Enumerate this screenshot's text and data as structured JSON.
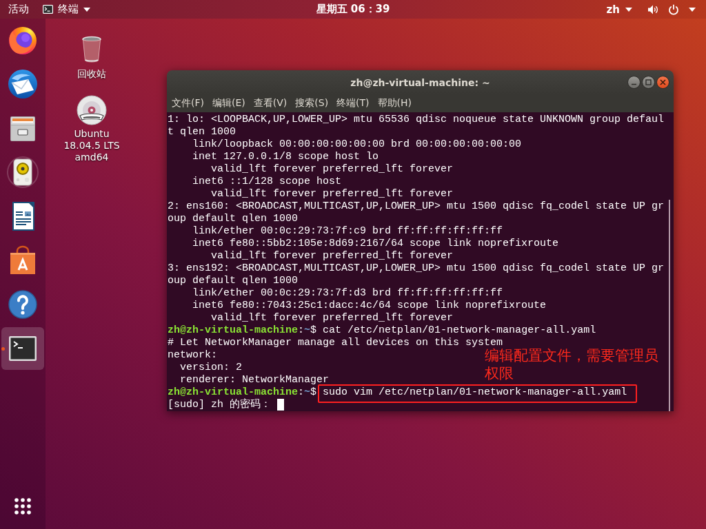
{
  "top_bar": {
    "activities": "活动",
    "app_menu": "终端",
    "clock": "星期五 06：39",
    "keyboard": "zh"
  },
  "dock": {
    "items": [
      {
        "kind": "browser",
        "running": false,
        "focused": false
      },
      {
        "kind": "mail",
        "running": false,
        "focused": false
      },
      {
        "kind": "files",
        "running": false,
        "focused": false
      },
      {
        "kind": "music",
        "running": false,
        "focused": false
      },
      {
        "kind": "writer",
        "running": false,
        "focused": false
      },
      {
        "kind": "store",
        "running": false,
        "focused": false
      },
      {
        "kind": "help",
        "running": false,
        "focused": false
      },
      {
        "kind": "terminal",
        "running": true,
        "focused": true
      }
    ]
  },
  "desktop": {
    "icons": [
      {
        "kind": "trash",
        "label": "回收站"
      },
      {
        "kind": "disc",
        "label": "Ubuntu 18.04.5 LTS amd64"
      }
    ]
  },
  "window": {
    "title": "zh@zh-virtual-machine: ~",
    "menu": [
      "文件(F)",
      "编辑(E)",
      "查看(V)",
      "搜索(S)",
      "终端(T)",
      "帮助(H)"
    ],
    "lines": [
      {
        "kind": "output",
        "text": "1: lo: <LOOPBACK,UP,LOWER_UP> mtu 65536 qdisc noqueue state UNKNOWN group defaul"
      },
      {
        "kind": "output",
        "text": "t qlen 1000"
      },
      {
        "kind": "output",
        "text": "    link/loopback 00:00:00:00:00:00 brd 00:00:00:00:00:00"
      },
      {
        "kind": "output",
        "text": "    inet 127.0.0.1/8 scope host lo"
      },
      {
        "kind": "output",
        "text": "       valid_lft forever preferred_lft forever"
      },
      {
        "kind": "output",
        "text": "    inet6 ::1/128 scope host"
      },
      {
        "kind": "output",
        "text": "       valid_lft forever preferred_lft forever"
      },
      {
        "kind": "output",
        "text": "2: ens160: <BROADCAST,MULTICAST,UP,LOWER_UP> mtu 1500 qdisc fq_codel state UP gr"
      },
      {
        "kind": "output",
        "text": "oup default qlen 1000"
      },
      {
        "kind": "output",
        "text": "    link/ether 00:0c:29:73:7f:c9 brd ff:ff:ff:ff:ff:ff"
      },
      {
        "kind": "output",
        "text": "    inet6 fe80::5bb2:105e:8d69:2167/64 scope link noprefixroute"
      },
      {
        "kind": "output",
        "text": "       valid_lft forever preferred_lft forever"
      },
      {
        "kind": "output",
        "text": "3: ens192: <BROADCAST,MULTICAST,UP,LOWER_UP> mtu 1500 qdisc fq_codel state UP gr"
      },
      {
        "kind": "output",
        "text": "oup default qlen 1000"
      },
      {
        "kind": "output",
        "text": "    link/ether 00:0c:29:73:7f:d3 brd ff:ff:ff:ff:ff:ff"
      },
      {
        "kind": "output",
        "text": "    inet6 fe80::7043:25c1:dacc:4c/64 scope link noprefixroute"
      },
      {
        "kind": "output",
        "text": "       valid_lft forever preferred_lft forever"
      },
      {
        "kind": "prompt",
        "user": "zh@zh-virtual-machine",
        "separator": ":",
        "path": "~",
        "symbol": "$",
        "command": "cat /etc/netplan/01-network-manager-all.yaml",
        "highlighted": false
      },
      {
        "kind": "output",
        "text": "# Let NetworkManager manage all devices on this system"
      },
      {
        "kind": "output",
        "text": "network:"
      },
      {
        "kind": "output",
        "text": "  version: 2"
      },
      {
        "kind": "output",
        "text": "  renderer: NetworkManager"
      },
      {
        "kind": "prompt",
        "user": "zh@zh-virtual-machine",
        "separator": ":",
        "path": "~",
        "symbol": "$",
        "command": "sudo vim /etc/netplan/01-network-manager-all.yaml",
        "highlighted": true
      },
      {
        "kind": "input",
        "text": "[sudo] zh 的密码：",
        "cursor": true
      }
    ],
    "annotation": "编辑配置文件，需要管理员权限"
  }
}
